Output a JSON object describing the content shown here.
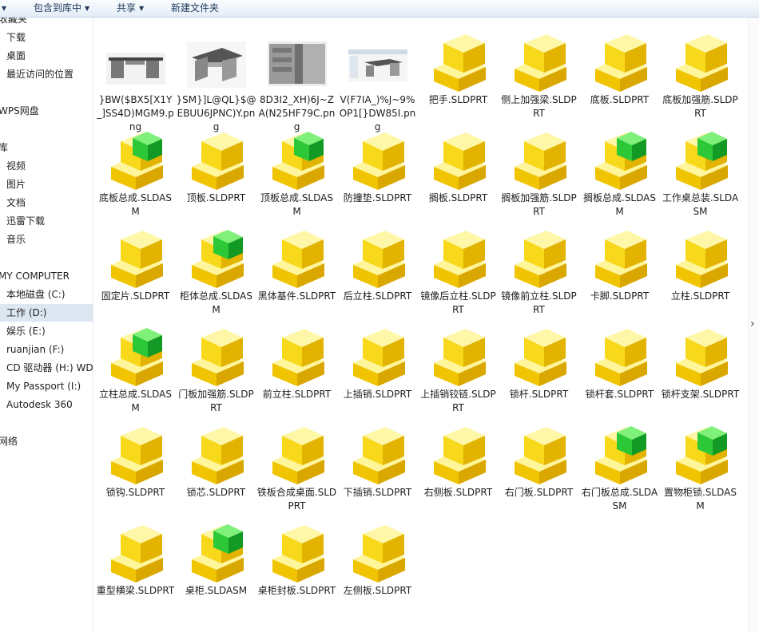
{
  "toolbar": {
    "left_arrow": "▾",
    "include_label": "包含到库中",
    "share_label": "共享",
    "new_folder_label": "新建文件夹"
  },
  "sidebar": {
    "items": [
      {
        "label": "收藏夹",
        "icon": "star-icon",
        "group": true
      },
      {
        "label": "下载",
        "icon": "download-folder-icon"
      },
      {
        "label": "桌面",
        "icon": "desktop-folder-icon"
      },
      {
        "label": "最近访问的位置",
        "icon": "recent-places-icon"
      },
      {
        "label": "WPS网盘",
        "icon": "cloud-drive-icon",
        "group": true
      },
      {
        "label": "库",
        "icon": "library-icon",
        "group": true
      },
      {
        "label": "视频",
        "icon": "video-library-icon"
      },
      {
        "label": "图片",
        "icon": "pictures-library-icon"
      },
      {
        "label": "文档",
        "icon": "documents-library-icon"
      },
      {
        "label": "迅雷下载",
        "icon": "xunlei-folder-icon"
      },
      {
        "label": "音乐",
        "icon": "music-library-icon"
      },
      {
        "label": "MY COMPUTER",
        "icon": "computer-icon",
        "group": true
      },
      {
        "label": "本地磁盘 (C:)",
        "icon": "drive-icon"
      },
      {
        "label": "工作 (D:)",
        "icon": "drive-icon",
        "selected": true
      },
      {
        "label": "娱乐 (E:)",
        "icon": "drive-icon"
      },
      {
        "label": "ruanjian (F:)",
        "icon": "drive-icon"
      },
      {
        "label": "CD 驱动器 (H:) WD",
        "icon": "cd-drive-icon"
      },
      {
        "label": "My Passport (I:)",
        "icon": "usb-drive-icon"
      },
      {
        "label": "Autodesk 360",
        "icon": "cloud-icon"
      },
      {
        "label": "网络",
        "icon": "network-icon",
        "group": true
      }
    ]
  },
  "files": [
    {
      "name": "}BW($BX5[X1Y_]SS4D)MGM9.png",
      "type": "png",
      "preview": "desk-gray-side"
    },
    {
      "name": "}SM}]L@QL}$@EBUU6JPNC)Y.png",
      "type": "png",
      "preview": "desk-iso"
    },
    {
      "name": "8D3I2_XH)6J~ZA(N25HF79C.png",
      "type": "png",
      "preview": "cabinet-open"
    },
    {
      "name": "V(F7IA_)%J~9%OP1[}DW85I.png",
      "type": "png",
      "preview": "desk-window"
    },
    {
      "name": "把手.SLDPRT",
      "type": "part"
    },
    {
      "name": "侧上加强梁.SLDPRT",
      "type": "part"
    },
    {
      "name": "底板.SLDPRT",
      "type": "part"
    },
    {
      "name": "底板加强筋.SLDPRT",
      "type": "part"
    },
    {
      "name": "底板总成.SLDASM",
      "type": "asm"
    },
    {
      "name": "顶板.SLDPRT",
      "type": "part"
    },
    {
      "name": "顶板总成.SLDASM",
      "type": "asm"
    },
    {
      "name": "防撞垫.SLDPRT",
      "type": "part"
    },
    {
      "name": "搁板.SLDPRT",
      "type": "part"
    },
    {
      "name": "搁板加强筋.SLDPRT",
      "type": "part"
    },
    {
      "name": "搁板总成.SLDASM",
      "type": "asm"
    },
    {
      "name": "工作桌总装.SLDASM",
      "type": "asm"
    },
    {
      "name": "固定片.SLDPRT",
      "type": "part"
    },
    {
      "name": "柜体总成.SLDASM",
      "type": "asm"
    },
    {
      "name": "黑体基件.SLDPRT",
      "type": "part"
    },
    {
      "name": "后立柱.SLDPRT",
      "type": "part"
    },
    {
      "name": "镜像后立柱.SLDPRT",
      "type": "part"
    },
    {
      "name": "镜像前立柱.SLDPRT",
      "type": "part"
    },
    {
      "name": "卡脚.SLDPRT",
      "type": "part"
    },
    {
      "name": "立柱.SLDPRT",
      "type": "part"
    },
    {
      "name": "立柱总成.SLDASM",
      "type": "asm"
    },
    {
      "name": "门板加强筋.SLDPRT",
      "type": "part"
    },
    {
      "name": "前立柱.SLDPRT",
      "type": "part"
    },
    {
      "name": "上插销.SLDPRT",
      "type": "part"
    },
    {
      "name": "上插销铰链.SLDPRT",
      "type": "part"
    },
    {
      "name": "锁杆.SLDPRT",
      "type": "part"
    },
    {
      "name": "锁杆套.SLDPRT",
      "type": "part"
    },
    {
      "name": "锁杆支架.SLDPRT",
      "type": "part"
    },
    {
      "name": "锁钩.SLDPRT",
      "type": "part"
    },
    {
      "name": "锁芯.SLDPRT",
      "type": "part"
    },
    {
      "name": "铁板合成桌面.SLDPRT",
      "type": "part"
    },
    {
      "name": "下插销.SLDPRT",
      "type": "part"
    },
    {
      "name": "右侧板.SLDPRT",
      "type": "part"
    },
    {
      "name": "右门板.SLDPRT",
      "type": "part"
    },
    {
      "name": "右门板总成.SLDASM",
      "type": "asm"
    },
    {
      "name": "置物柜锁.SLDASM",
      "type": "asm"
    },
    {
      "name": "重型横梁.SLDPRT",
      "type": "part"
    },
    {
      "name": "桌柜.SLDASM",
      "type": "asm"
    },
    {
      "name": "桌柜封板.SLDPRT",
      "type": "part"
    },
    {
      "name": "左侧板.SLDPRT",
      "type": "part"
    }
  ],
  "colors": {
    "part_yellow": "#f5cf0c",
    "assembly_green": "#1fb83a",
    "selected_nav": "#dde7f2"
  }
}
